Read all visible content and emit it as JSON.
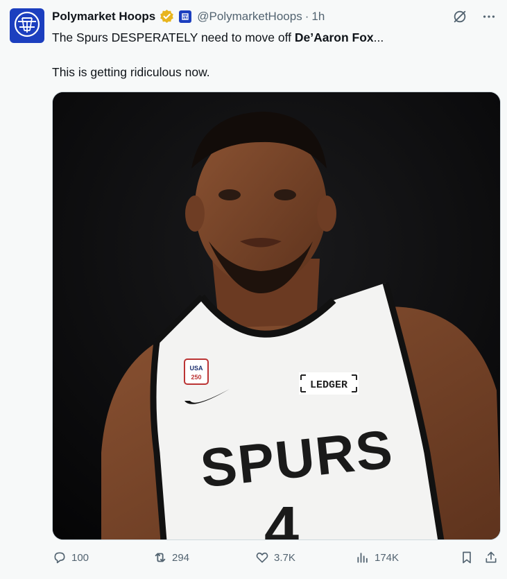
{
  "author": {
    "display_name": "Polymarket Hoops",
    "handle": "@PolymarketHoops",
    "separator": "·",
    "time": "1h",
    "avatar_icon": "basketball-net-icon",
    "verified_color": "#e8b51d",
    "brand_color": "#1c3fbf"
  },
  "post": {
    "line1_prefix": "The Spurs DESPERATELY need to move off ",
    "line1_bold": "De’Aaron Fox",
    "line1_suffix": "...",
    "line2": "This is getting ridiculous now."
  },
  "media": {
    "jersey_patch": "LEDGER",
    "jersey_team": "SPURS",
    "jersey_number": "4",
    "usa_patch_line1": "USA",
    "usa_patch_line2": "250"
  },
  "actions": {
    "replies": "100",
    "reposts": "294",
    "likes": "3.7K",
    "views": "174K"
  }
}
